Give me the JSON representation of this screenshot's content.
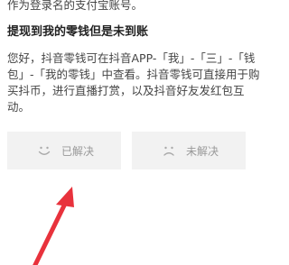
{
  "intro": {
    "text": "作为登录名的支付宝账号。"
  },
  "faq": {
    "title": "提现到我的零钱但是未到账",
    "answer_lines": [
      "您好，抖音零钱可在抖音APP-「我」-「三」-「钱",
      "包」-「我的零钱」中查看。抖音零钱可直接用于购",
      "买抖币，进行直播打赏，以及抖音好友发红包互",
      "动。"
    ]
  },
  "feedback": {
    "solved_label": "已解决",
    "unsolved_label": "未解决",
    "solved_icon": "smile-icon",
    "unsolved_icon": "frown-icon"
  },
  "annotation": {
    "arrow_color": "#e8323c"
  }
}
